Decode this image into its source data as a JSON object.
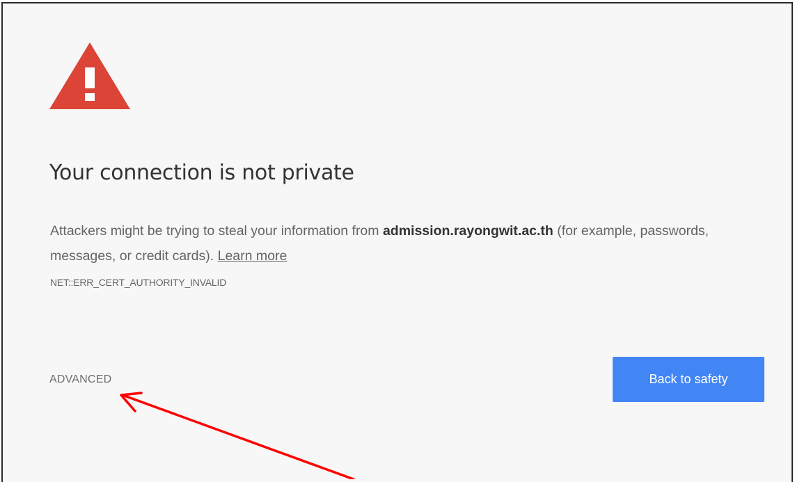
{
  "page": {
    "title": "Your connection is not private",
    "message_prefix": "Attackers might be trying to steal your information from ",
    "domain": "admission.rayongwit.ac.th",
    "message_suffix": " (for example, passwords, messages, or credit cards). ",
    "learn_more_label": "Learn more",
    "error_code": "NET::ERR_CERT_AUTHORITY_INVALID"
  },
  "actions": {
    "advanced_label": "ADVANCED",
    "back_label": "Back to safety"
  },
  "icons": {
    "warning": "warning-triangle-icon",
    "annotation": "red-arrow"
  },
  "colors": {
    "warning_red": "#db4437",
    "button_blue": "#4285f4",
    "annotation_red": "#ff0000",
    "page_background": "#f7f7f7"
  }
}
